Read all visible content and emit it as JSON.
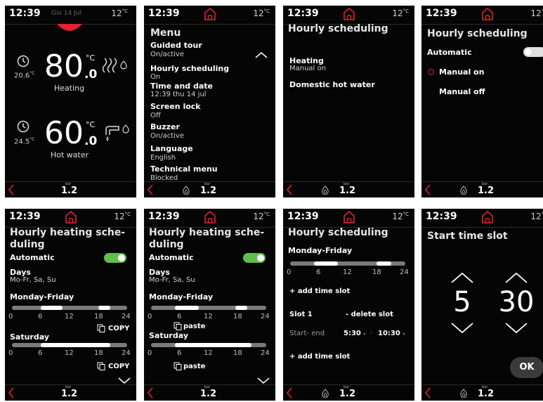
{
  "status_bar": {
    "time": "12:39",
    "date": "Gio 14 Jul",
    "outdoor_temp": "12",
    "temp_unit": "°C"
  },
  "bottom_bar": {
    "pressure_unit": "bar",
    "pressure": "1.2"
  },
  "colors": {
    "accent_red": "#e0232e",
    "toggle_on": "#5fbf4b",
    "toggle_off": "#e0e0e0"
  },
  "panel1": {
    "heating": {
      "set_int": "80",
      "set_dec": ".0",
      "unit": "°C",
      "current": "20.6",
      "current_unit": "°C",
      "label": "Heating"
    },
    "hot_water": {
      "set_int": "60",
      "set_dec": ".0",
      "unit": "°C",
      "current": "24.5",
      "current_unit": "°C",
      "label": "Hot water"
    }
  },
  "panel2": {
    "title": "Menu",
    "items": [
      {
        "label": "Guided tour",
        "value": "On/active"
      },
      {
        "label": "Hourly scheduling",
        "value": "On"
      },
      {
        "label": "Time and date",
        "value": "12:39 thu 14 jul"
      },
      {
        "label": "Screen lock",
        "value": "Off"
      },
      {
        "label": "Buzzer",
        "value": "On/active"
      },
      {
        "label": "Language",
        "value": "English"
      },
      {
        "label": "Technical menu",
        "value": "Blocked"
      }
    ]
  },
  "panel3": {
    "title": "Hourly scheduling",
    "heating_label": "Heating",
    "heating_value": "Manual on",
    "dhw_label": "Domestic hot water"
  },
  "panel4": {
    "title": "Hourly scheduling",
    "automatic_label": "Automatic",
    "automatic_on": false,
    "manual_on": "Manual on",
    "manual_off": "Manual off",
    "selected": "Manual on"
  },
  "panel5": {
    "title_line1": "Hourly heating sche-",
    "title_line2": "duling",
    "automatic_label": "Automatic",
    "automatic_on": true,
    "days_label": "Days",
    "days_value": "Mo-Fr, Sa, Su",
    "group1": "Monday-Friday",
    "group2": "Saturday",
    "ticks": [
      "0",
      "6",
      "12",
      "18",
      "24"
    ],
    "copy_label": "COPY",
    "schedule1": [
      [
        6,
        10.5
      ],
      [
        18,
        20.5
      ]
    ],
    "schedule2": [
      [
        6,
        20.5
      ]
    ]
  },
  "panel6": {
    "title_line1": "Hourly heating sche-",
    "title_line2": "duling",
    "automatic_label": "Automatic",
    "automatic_on": true,
    "days_label": "Days",
    "days_value": "Mo-Fr, Sa, Su",
    "group1": "Monday-Friday",
    "group2": "Saturday",
    "ticks": [
      "0",
      "6",
      "12",
      "18",
      "24"
    ],
    "paste_label": "paste",
    "schedule1": [
      [
        5,
        10
      ],
      [
        17.5,
        20
      ]
    ],
    "schedule2": [
      [
        5,
        21
      ]
    ]
  },
  "panel7": {
    "title": "Hourly scheduling",
    "group": "Monday-Friday",
    "ticks": [
      "0",
      "6",
      "12",
      "18",
      "24"
    ],
    "schedule": [
      [
        5,
        10
      ],
      [
        18,
        21
      ]
    ],
    "add_slot": "+ add time slot",
    "slot_label": "Slot 1",
    "delete_slot": "- delete slot",
    "start_end_label": "Start- end",
    "start": "5:30",
    "end": "10:30",
    "add_slot2": "+ add time slot"
  },
  "panel8": {
    "title": "Start time slot",
    "hour": "5",
    "minute": "30",
    "ok": "OK"
  }
}
